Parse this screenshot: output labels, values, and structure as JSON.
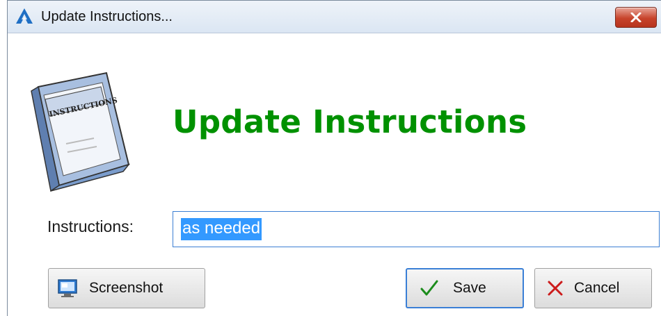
{
  "window": {
    "title": "Update Instructions...",
    "app_icon": "app-logo-icon",
    "close_icon": "close-icon"
  },
  "dialog": {
    "heading": "Update Instructions",
    "heading_color": "#009100",
    "book_icon": "instructions-book-icon",
    "book_label": "INSTRUCTIONS"
  },
  "form": {
    "instructions_label": "Instructions:",
    "instructions_value": "as needed"
  },
  "buttons": {
    "screenshot_label": "Screenshot",
    "save_label": "Save",
    "cancel_label": "Cancel"
  },
  "colors": {
    "selection": "#3399ff",
    "focus_border": "#3a7fd6",
    "close_button": "#c7432b"
  }
}
